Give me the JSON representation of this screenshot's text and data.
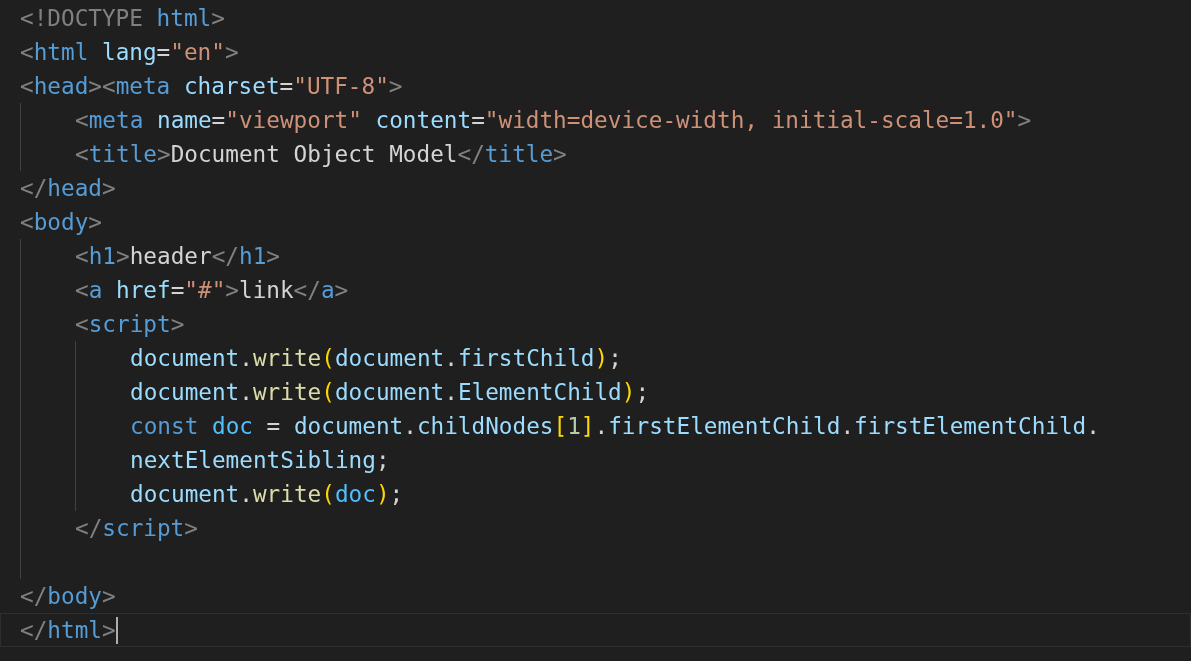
{
  "editor": {
    "lines": [
      {
        "current": false,
        "tokens": [
          {
            "kind": "punct_tag",
            "text": "<!DOCTYPE "
          },
          {
            "kind": "tag",
            "text": "html"
          },
          {
            "kind": "punct_tag",
            "text": ">"
          }
        ]
      },
      {
        "current": false,
        "tokens": [
          {
            "kind": "punct_tag",
            "text": "<"
          },
          {
            "kind": "tag",
            "text": "html "
          },
          {
            "kind": "attr",
            "text": "lang"
          },
          {
            "kind": "plain",
            "text": "="
          },
          {
            "kind": "string",
            "text": "\"en\""
          },
          {
            "kind": "punct_tag",
            "text": ">"
          }
        ]
      },
      {
        "current": false,
        "tokens": [
          {
            "kind": "punct_tag",
            "text": "<"
          },
          {
            "kind": "tag",
            "text": "head"
          },
          {
            "kind": "punct_tag",
            "text": "><"
          },
          {
            "kind": "tag",
            "text": "meta "
          },
          {
            "kind": "attr",
            "text": "charset"
          },
          {
            "kind": "plain",
            "text": "="
          },
          {
            "kind": "string",
            "text": "\"UTF-8\""
          },
          {
            "kind": "punct_tag",
            "text": ">"
          }
        ],
        "children": [
          {
            "current": false,
            "tokens": [
              {
                "kind": "punct_tag",
                "text": "<"
              },
              {
                "kind": "tag",
                "text": "meta "
              },
              {
                "kind": "attr",
                "text": "name"
              },
              {
                "kind": "plain",
                "text": "="
              },
              {
                "kind": "string",
                "text": "\"viewport\" "
              },
              {
                "kind": "attr",
                "text": "content"
              },
              {
                "kind": "plain",
                "text": "="
              },
              {
                "kind": "string",
                "text": "\"width=device-width, initial-scale=1.0\""
              },
              {
                "kind": "punct_tag",
                "text": ">"
              }
            ]
          },
          {
            "current": false,
            "tokens": [
              {
                "kind": "punct_tag",
                "text": "<"
              },
              {
                "kind": "tag",
                "text": "title"
              },
              {
                "kind": "punct_tag",
                "text": ">"
              },
              {
                "kind": "plain",
                "text": "Document Object Model"
              },
              {
                "kind": "punct_tag",
                "text": "</"
              },
              {
                "kind": "tag",
                "text": "title"
              },
              {
                "kind": "punct_tag",
                "text": ">"
              }
            ]
          }
        ]
      },
      {
        "current": false,
        "tokens": [
          {
            "kind": "punct_tag",
            "text": "</"
          },
          {
            "kind": "tag",
            "text": "head"
          },
          {
            "kind": "punct_tag",
            "text": ">"
          }
        ]
      },
      {
        "current": false,
        "tokens": [
          {
            "kind": "punct_tag",
            "text": "<"
          },
          {
            "kind": "tag",
            "text": "body"
          },
          {
            "kind": "punct_tag",
            "text": ">"
          }
        ],
        "children": [
          {
            "current": false,
            "tokens": [
              {
                "kind": "punct_tag",
                "text": "<"
              },
              {
                "kind": "tag",
                "text": "h1"
              },
              {
                "kind": "punct_tag",
                "text": ">"
              },
              {
                "kind": "plain",
                "text": "header"
              },
              {
                "kind": "punct_tag",
                "text": "</"
              },
              {
                "kind": "tag",
                "text": "h1"
              },
              {
                "kind": "punct_tag",
                "text": ">"
              }
            ]
          },
          {
            "current": false,
            "tokens": [
              {
                "kind": "punct_tag",
                "text": "<"
              },
              {
                "kind": "tag",
                "text": "a "
              },
              {
                "kind": "attr",
                "text": "href"
              },
              {
                "kind": "plain",
                "text": "="
              },
              {
                "kind": "string",
                "text": "\"#\""
              },
              {
                "kind": "punct_tag",
                "text": ">"
              },
              {
                "kind": "plain",
                "text": "link"
              },
              {
                "kind": "punct_tag",
                "text": "</"
              },
              {
                "kind": "tag",
                "text": "a"
              },
              {
                "kind": "punct_tag",
                "text": ">"
              }
            ]
          },
          {
            "current": false,
            "tokens": [
              {
                "kind": "punct_tag",
                "text": "<"
              },
              {
                "kind": "tag",
                "text": "script"
              },
              {
                "kind": "punct_tag",
                "text": ">"
              }
            ],
            "children": [
              {
                "current": false,
                "tokens": [
                  {
                    "kind": "variable",
                    "text": "document"
                  },
                  {
                    "kind": "plain",
                    "text": "."
                  },
                  {
                    "kind": "function",
                    "text": "write"
                  },
                  {
                    "kind": "bracket",
                    "text": "("
                  },
                  {
                    "kind": "variable",
                    "text": "document"
                  },
                  {
                    "kind": "plain",
                    "text": "."
                  },
                  {
                    "kind": "variable",
                    "text": "firstChild"
                  },
                  {
                    "kind": "bracket",
                    "text": ")"
                  },
                  {
                    "kind": "plain",
                    "text": ";"
                  }
                ]
              },
              {
                "current": false,
                "tokens": [
                  {
                    "kind": "variable",
                    "text": "document"
                  },
                  {
                    "kind": "plain",
                    "text": "."
                  },
                  {
                    "kind": "function",
                    "text": "write"
                  },
                  {
                    "kind": "bracket",
                    "text": "("
                  },
                  {
                    "kind": "variable",
                    "text": "document"
                  },
                  {
                    "kind": "plain",
                    "text": "."
                  },
                  {
                    "kind": "variable",
                    "text": "ElementChild"
                  },
                  {
                    "kind": "bracket",
                    "text": ")"
                  },
                  {
                    "kind": "plain",
                    "text": ";"
                  }
                ]
              },
              {
                "current": false,
                "tokens": [
                  {
                    "kind": "keyword",
                    "text": "const "
                  },
                  {
                    "kind": "constant",
                    "text": "doc"
                  },
                  {
                    "kind": "plain",
                    "text": " = "
                  },
                  {
                    "kind": "variable",
                    "text": "document"
                  },
                  {
                    "kind": "plain",
                    "text": "."
                  },
                  {
                    "kind": "variable",
                    "text": "childNodes"
                  },
                  {
                    "kind": "bracket",
                    "text": "["
                  },
                  {
                    "kind": "number",
                    "text": "1"
                  },
                  {
                    "kind": "bracket",
                    "text": "]"
                  },
                  {
                    "kind": "plain",
                    "text": "."
                  },
                  {
                    "kind": "variable",
                    "text": "firstElementChild"
                  },
                  {
                    "kind": "plain",
                    "text": "."
                  },
                  {
                    "kind": "variable",
                    "text": "firstElementChild"
                  },
                  {
                    "kind": "plain",
                    "text": "."
                  }
                ]
              },
              {
                "current": false,
                "tokens": [
                  {
                    "kind": "variable",
                    "text": "nextElementSibling"
                  },
                  {
                    "kind": "plain",
                    "text": ";"
                  }
                ]
              },
              {
                "current": false,
                "tokens": [
                  {
                    "kind": "variable",
                    "text": "document"
                  },
                  {
                    "kind": "plain",
                    "text": "."
                  },
                  {
                    "kind": "function",
                    "text": "write"
                  },
                  {
                    "kind": "bracket",
                    "text": "("
                  },
                  {
                    "kind": "constant",
                    "text": "doc"
                  },
                  {
                    "kind": "bracket",
                    "text": ")"
                  },
                  {
                    "kind": "plain",
                    "text": ";"
                  }
                ]
              }
            ]
          },
          {
            "current": false,
            "tokens": [
              {
                "kind": "punct_tag",
                "text": "</"
              },
              {
                "kind": "tag",
                "text": "script"
              },
              {
                "kind": "punct_tag",
                "text": ">"
              }
            ]
          },
          {
            "current": false
          }
        ]
      },
      {
        "current": false,
        "tokens": [
          {
            "kind": "punct_tag",
            "text": "</"
          },
          {
            "kind": "tag",
            "text": "body"
          },
          {
            "kind": "punct_tag",
            "text": ">"
          }
        ]
      },
      {
        "current": true,
        "tokens": [
          {
            "kind": "punct_tag",
            "text": "</"
          },
          {
            "kind": "tag",
            "text": "html"
          },
          {
            "kind": "punct_tag",
            "text": ">"
          }
        ]
      }
    ]
  }
}
